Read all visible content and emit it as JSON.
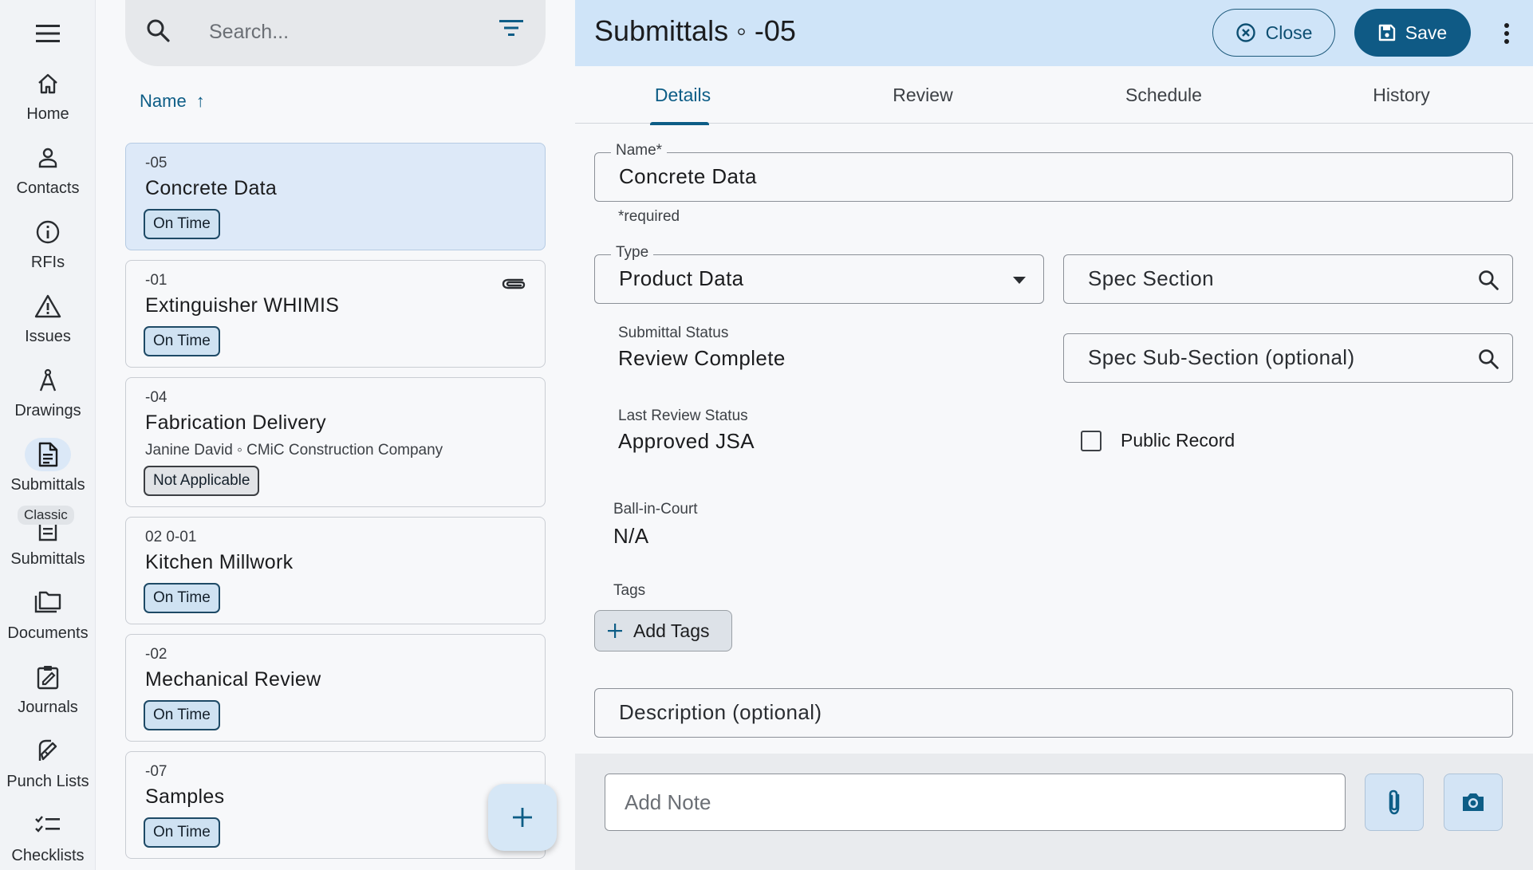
{
  "nav": {
    "items": [
      {
        "label": "Home",
        "icon": "home-icon"
      },
      {
        "label": "Contacts",
        "icon": "person-icon"
      },
      {
        "label": "RFIs",
        "icon": "info-icon"
      },
      {
        "label": "Issues",
        "icon": "warning-icon"
      },
      {
        "label": "Drawings",
        "icon": "compass-icon"
      },
      {
        "label": "Submittals",
        "icon": "document-icon"
      },
      {
        "label": "Submittals",
        "icon": "document-icon"
      },
      {
        "label": "Documents",
        "icon": "folder-icon"
      },
      {
        "label": "Journals",
        "icon": "journal-icon"
      },
      {
        "label": "Punch Lists",
        "icon": "punch-icon"
      },
      {
        "label": "Checklists",
        "icon": "checklist-icon"
      }
    ],
    "classic_badge": "Classic"
  },
  "list": {
    "search_placeholder": "Search...",
    "sort_label": "Name",
    "sort_arrow": "↑",
    "cards": [
      {
        "id": "-05",
        "title": "Concrete Data",
        "subtitle": "",
        "status": "On Time"
      },
      {
        "id": "-01",
        "title": "Extinguisher WHIMIS",
        "subtitle": "",
        "status": "On Time"
      },
      {
        "id": "-04",
        "title": "Fabrication Delivery",
        "subtitle": "Janine David ◦ CMiC Construction Company",
        "status": "Not Applicable"
      },
      {
        "id": "02 0-01",
        "title": "Kitchen Millwork",
        "subtitle": "",
        "status": "On Time"
      },
      {
        "id": "-02",
        "title": "Mechanical Review",
        "subtitle": "",
        "status": "On Time"
      },
      {
        "id": "-07",
        "title": "Samples",
        "subtitle": "",
        "status": "On Time"
      }
    ]
  },
  "detail": {
    "title": "Submittals ◦ -05",
    "close_label": "Close",
    "save_label": "Save",
    "tabs": [
      "Details",
      "Review",
      "Schedule",
      "History"
    ],
    "name_label": "Name*",
    "name_value": "Concrete Data",
    "required_helper": "*required",
    "type_label": "Type",
    "type_value": "Product Data",
    "spec_section_placeholder": "Spec Section",
    "spec_subsection_placeholder": "Spec Sub-Section (optional)",
    "submittal_status_label": "Submittal Status",
    "submittal_status_value": "Review Complete",
    "last_review_label": "Last Review Status",
    "last_review_value": "Approved JSA",
    "public_record_label": "Public Record",
    "ball_in_court_label": "Ball-in-Court",
    "ball_in_court_value": "N/A",
    "tags_label": "Tags",
    "add_tags_label": "Add Tags",
    "description_placeholder": "Description (optional)",
    "note_placeholder": "Add Note"
  },
  "colors": {
    "accent": "#0d5d86",
    "header_bg": "#cfe4f8",
    "save_bg": "#0f5a85"
  }
}
